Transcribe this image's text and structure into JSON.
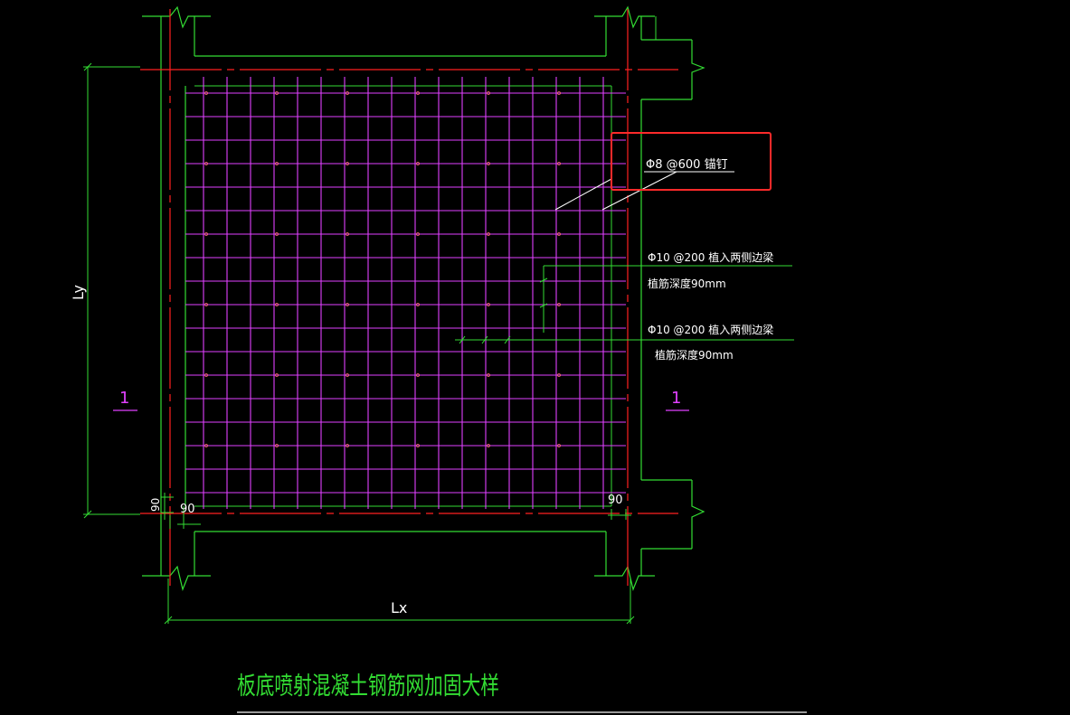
{
  "labels": {
    "dowel": "Φ8 @600 锚钉",
    "rebar1_line1": "Φ10 @200 植入两侧边梁",
    "rebar1_line2": "植筋深度90mm",
    "rebar2_line1": "Φ10 @200 植入两侧边梁",
    "rebar2_line2": "植筋深度90mm",
    "dim_ly": "Ly",
    "dim_lx": "Lx",
    "dim_90_left_v": "90",
    "dim_90_left_h": "90",
    "dim_90_right": "90",
    "section_left": "1",
    "section_right": "1",
    "title": "板底喷射混凝土钢筋网加固大样"
  },
  "colors": {
    "background": "#000000",
    "beam_line": "#33dd33",
    "axis_line": "#ff2020",
    "mesh": "#e040ff",
    "text": "#ffffff",
    "highlight": "#ff2a2a",
    "title": "#33dd33",
    "section_mark": "#e040ff"
  }
}
